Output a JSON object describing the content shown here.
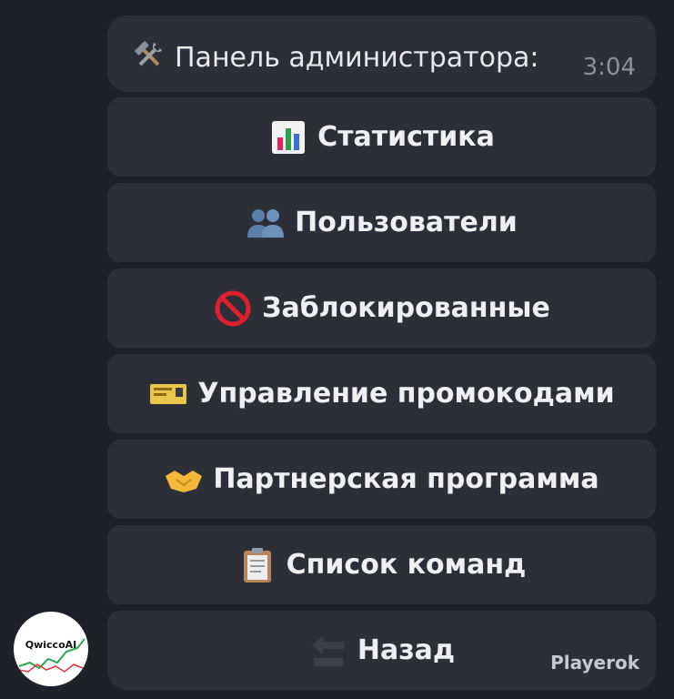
{
  "message": {
    "icon": "hammer-and-wrench-icon",
    "text": "Панель администратора:",
    "time": "3:04"
  },
  "keyboard": {
    "buttons": [
      {
        "icon": "bar-chart-icon",
        "label": "Статистика"
      },
      {
        "icon": "users-icon",
        "label": "Пользователи"
      },
      {
        "icon": "no-entry-icon",
        "label": "Заблокированные"
      },
      {
        "icon": "ticket-icon",
        "label": "Управление промокодами"
      },
      {
        "icon": "handshake-icon",
        "label": "Партнерская программа"
      },
      {
        "icon": "clipboard-icon",
        "label": "Список команд"
      },
      {
        "icon": "back-arrow-icon",
        "label": "Назад"
      }
    ],
    "via_label": "Playerok"
  },
  "avatar": {
    "text": "QwiccoAI"
  }
}
